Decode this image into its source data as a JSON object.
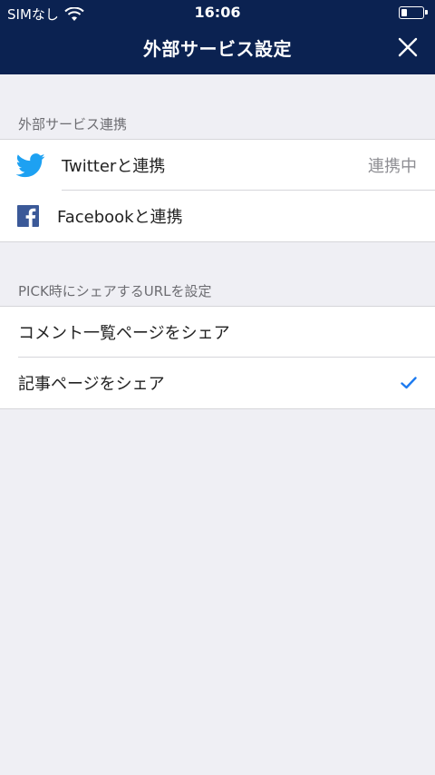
{
  "status_bar": {
    "carrier": "SIMなし",
    "time": "16:06",
    "battery_level": 0.3
  },
  "nav": {
    "title": "外部サービス設定",
    "close_icon": "close-icon"
  },
  "sections": {
    "external_services": {
      "header": "外部サービス連携",
      "twitter": {
        "label": "Twitterと連携",
        "status": "連携中",
        "icon": "twitter-icon"
      },
      "facebook": {
        "label": "Facebookと連携",
        "icon": "facebook-icon"
      }
    },
    "share_url": {
      "header": "PICK時にシェアするURLを設定",
      "options": [
        {
          "label": "コメント一覧ページをシェア",
          "selected": false
        },
        {
          "label": "記事ページをシェア",
          "selected": true
        }
      ]
    }
  },
  "colors": {
    "nav_background": "#0b2251",
    "page_background": "#efeff4",
    "twitter_blue": "#1da1f2",
    "facebook_blue": "#3b5998",
    "check_blue": "#1d7bf0"
  }
}
